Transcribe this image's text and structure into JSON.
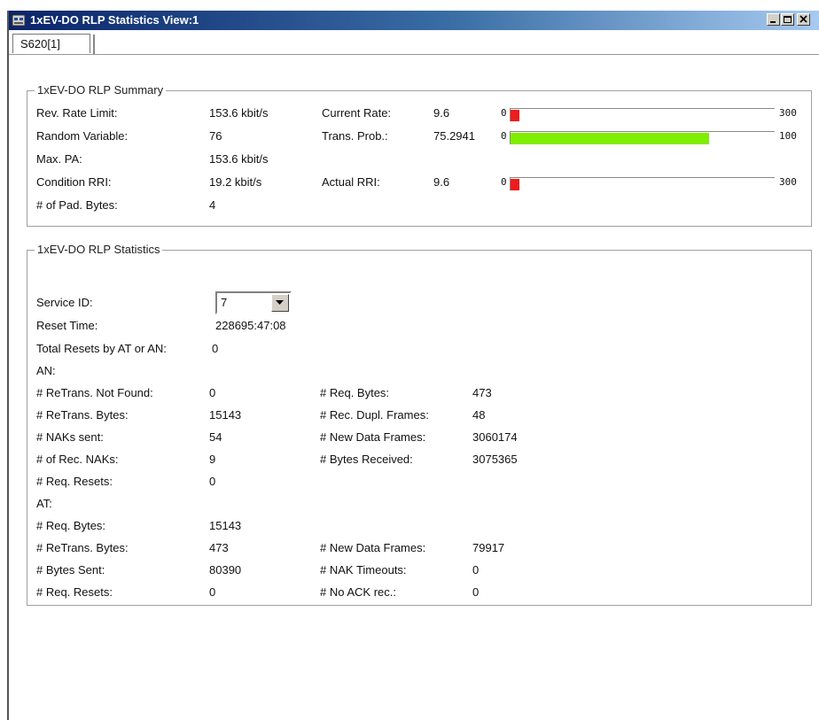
{
  "window": {
    "title": "1xEV-DO RLP Statistics View:1",
    "tab": "S620[1]",
    "icons": {
      "app": "app-icon",
      "minimize": "minimize-icon",
      "maximize": "maximize-icon",
      "close": "close-icon"
    }
  },
  "summary": {
    "legend": "1xEV-DO RLP Summary",
    "rows": [
      {
        "label": "Rev. Rate Limit:",
        "value": "153.6 kbit/s"
      },
      {
        "label": "Random Variable:",
        "value": "76"
      },
      {
        "label": "Max. PA:",
        "value": "153.6 kbit/s"
      },
      {
        "label": "Condition RRI:",
        "value": "19.2 kbit/s"
      },
      {
        "label": "# of Pad. Bytes:",
        "value": "4"
      }
    ],
    "meters": [
      {
        "label": "Current Rate:",
        "value": "9.6",
        "min": "0",
        "max": "300",
        "level": 0.032,
        "color": "#ee1c1c"
      },
      {
        "label": "Trans. Prob.:",
        "value": "75.2941",
        "min": "0",
        "max": "100",
        "level": 0.7529,
        "color": "#80ee00"
      },
      {
        "label": "Actual RRI:",
        "value": "9.6",
        "min": "0",
        "max": "300",
        "level": 0.032,
        "color": "#ee1c1c"
      }
    ]
  },
  "stats": {
    "legend": "1xEV-DO RLP Statistics",
    "service_id_label": "Service ID:",
    "service_id_value": "7",
    "reset_time_label": "Reset Time:",
    "reset_time_value": "228695:47:08",
    "total_resets_label": "Total Resets by AT or AN:",
    "total_resets_value": "0",
    "an_label": "AN:",
    "an_left": [
      {
        "label": "# ReTrans. Not Found:",
        "value": "0"
      },
      {
        "label": "# ReTrans. Bytes:",
        "value": "15143"
      },
      {
        "label": "# NAKs sent:",
        "value": "54"
      },
      {
        "label": "# of Rec. NAKs:",
        "value": "9"
      },
      {
        "label": "# Req. Resets:",
        "value": "0"
      }
    ],
    "an_right": [
      {
        "label": "# Req. Bytes:",
        "value": "473"
      },
      {
        "label": "# Rec. Dupl. Frames:",
        "value": "48"
      },
      {
        "label": "# New Data Frames:",
        "value": "3060174"
      },
      {
        "label": "# Bytes Received:",
        "value": "3075365"
      }
    ],
    "at_label": "AT:",
    "at_left": [
      {
        "label": "# Req. Bytes:",
        "value": "15143"
      },
      {
        "label": "# ReTrans. Bytes:",
        "value": "473"
      },
      {
        "label": "# Bytes Sent:",
        "value": "80390"
      },
      {
        "label": "# Req. Resets:",
        "value": "0"
      }
    ],
    "at_right": [
      {
        "label": "# New Data Frames:",
        "value": "79917"
      },
      {
        "label": "# NAK Timeouts:",
        "value": "0"
      },
      {
        "label": "# No ACK rec.:",
        "value": "0"
      }
    ]
  }
}
